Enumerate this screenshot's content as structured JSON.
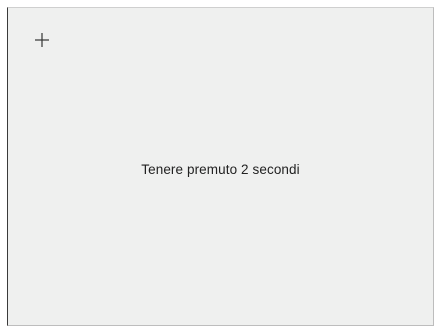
{
  "screen": {
    "background_color": "#eff0ef",
    "add_button": {
      "icon": "plus-icon",
      "color": "#333333"
    },
    "instruction_text": "Tenere premuto 2 secondi"
  }
}
